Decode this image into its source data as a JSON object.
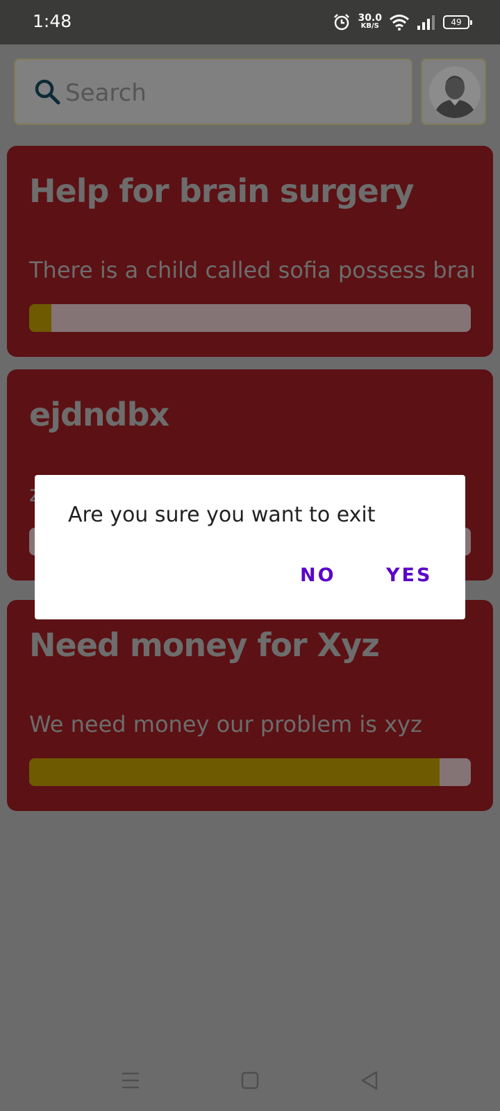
{
  "status_bar": {
    "time": "1:48",
    "speed_value": "30.0",
    "speed_unit": "KB/S",
    "battery": "49",
    "icons": [
      "alarm-icon",
      "wifi-icon",
      "signal-icon",
      "battery-icon"
    ]
  },
  "search": {
    "placeholder": "Search"
  },
  "campaigns": [
    {
      "title": "Help for brain surgery",
      "description": "There is a child called sofia possess bran",
      "progress_percent": 5
    },
    {
      "title": "ejdndbx",
      "description": "z",
      "progress_percent": 0
    },
    {
      "title": "Need money for Xyz",
      "description": "We need money our problem is xyz",
      "progress_percent": 93
    }
  ],
  "dialog": {
    "message": "Are you sure you want to exit",
    "no_label": "NO",
    "yes_label": "YES"
  },
  "colors": {
    "card_background": "#5c1114",
    "progress_fill": "#6e5a00",
    "dialog_button": "#5b05c9",
    "scrim_background": "#6b6b6b"
  }
}
